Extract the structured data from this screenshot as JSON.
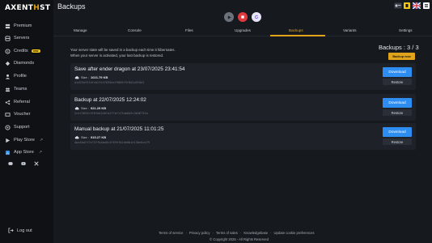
{
  "brand": {
    "logo_main": "AXENT",
    "logo_accent": "H",
    "logo_tail": "ST",
    "accent_color": "#e0a31a"
  },
  "header": {
    "title": "Backups"
  },
  "sidebar": {
    "items": [
      {
        "label": "Premium",
        "icon": "server-icon"
      },
      {
        "label": "Servers",
        "icon": "server-stack-icon"
      },
      {
        "label": "Credits",
        "icon": "credit-icon",
        "badge": "new"
      },
      {
        "label": "Diamonds",
        "icon": "diamond-icon"
      },
      {
        "label": "Profile",
        "icon": "user-icon"
      },
      {
        "label": "Teams",
        "icon": "team-icon"
      },
      {
        "label": "Referral",
        "icon": "referral-icon"
      },
      {
        "label": "Voucher",
        "icon": "voucher-icon"
      },
      {
        "label": "Support",
        "icon": "support-icon"
      },
      {
        "label": "Play Store",
        "icon": "play-store-icon"
      },
      {
        "label": "App Store",
        "icon": "app-store-icon"
      }
    ],
    "logout": "Log out"
  },
  "tabs": [
    "Manage",
    "Console",
    "Files",
    "Upgrades",
    "Backups",
    "Variants",
    "Settings"
  ],
  "active_tab": "Backups",
  "info": {
    "line1": "Your server state will be saved in a backup each time it hibernates.",
    "line2": "When your server is activated, your last backup is restored."
  },
  "backups_count": "Backups : 3 / 3",
  "create_button": "Backup now",
  "size_label": "Size :",
  "download_label": "Download",
  "restore_label": "Restore",
  "backups": [
    {
      "title": "Save after ender dragon at 23/07/2025 23:41:54",
      "size": "1021.79 KB",
      "hash": "a1d23af5fdfcb2fe37839dcf9865f5f8d2d5f0d1"
    },
    {
      "title": "Backup at 22/07/2025 12:24:02",
      "size": "921.29 KB",
      "hash": "2c4f3653c3f6feb2e0fa2f7ef1f3ab6b3c3b36755a"
    },
    {
      "title": "Manual backup at 21/07/2025 11:01:25",
      "size": "915.27 KB",
      "hash": "4ba4bdff7e737fb4be0c4f6f6fb2de8b1e13be0ce79"
    }
  ],
  "footer": {
    "links": [
      "Terms of service",
      "Privacy policy",
      "Terms of sales",
      "Knowledgebase",
      "Update cookie preferences"
    ],
    "copyright": "© Copyright 2025 - All Rights Reserved"
  }
}
